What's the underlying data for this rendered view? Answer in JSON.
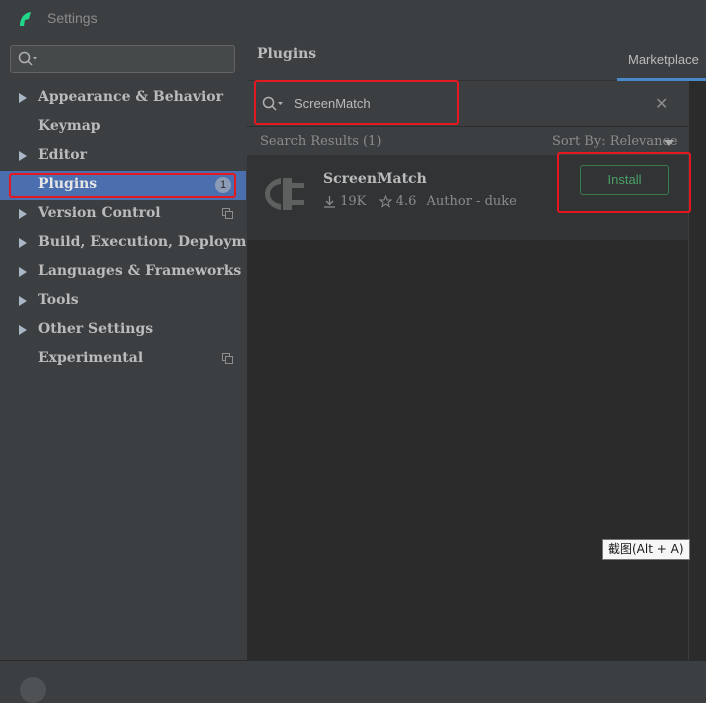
{
  "window": {
    "title": "Settings"
  },
  "sidebar": {
    "search_placeholder": "",
    "items": [
      {
        "label": "Appearance & Behavior",
        "expandable": true
      },
      {
        "label": "Keymap",
        "expandable": false
      },
      {
        "label": "Editor",
        "expandable": true
      },
      {
        "label": "Plugins",
        "expandable": false,
        "selected": true,
        "badge": "1"
      },
      {
        "label": "Version Control",
        "expandable": true
      },
      {
        "label": "Build, Execution, Deployment",
        "expandable": true
      },
      {
        "label": "Languages & Frameworks",
        "expandable": true
      },
      {
        "label": "Tools",
        "expandable": true
      },
      {
        "label": "Other Settings",
        "expandable": true
      },
      {
        "label": "Experimental",
        "expandable": false
      }
    ]
  },
  "plugins": {
    "title": "Plugins",
    "tab_marketplace": "Marketplace",
    "search_value": "ScreenMatch",
    "results_label": "Search Results (1)",
    "sort_label": "Sort By: Relevance",
    "results": [
      {
        "name": "ScreenMatch",
        "downloads": "19K",
        "rating": "4.6",
        "author": "Author - duke",
        "action": "Install"
      }
    ]
  },
  "tooltip": {
    "text": "截图(Alt + A)"
  },
  "colors": {
    "accent": "#4b6eaf",
    "highlight": "#e3191f",
    "install_green": "#4aa167",
    "tab_underline": "#4a88c7"
  }
}
